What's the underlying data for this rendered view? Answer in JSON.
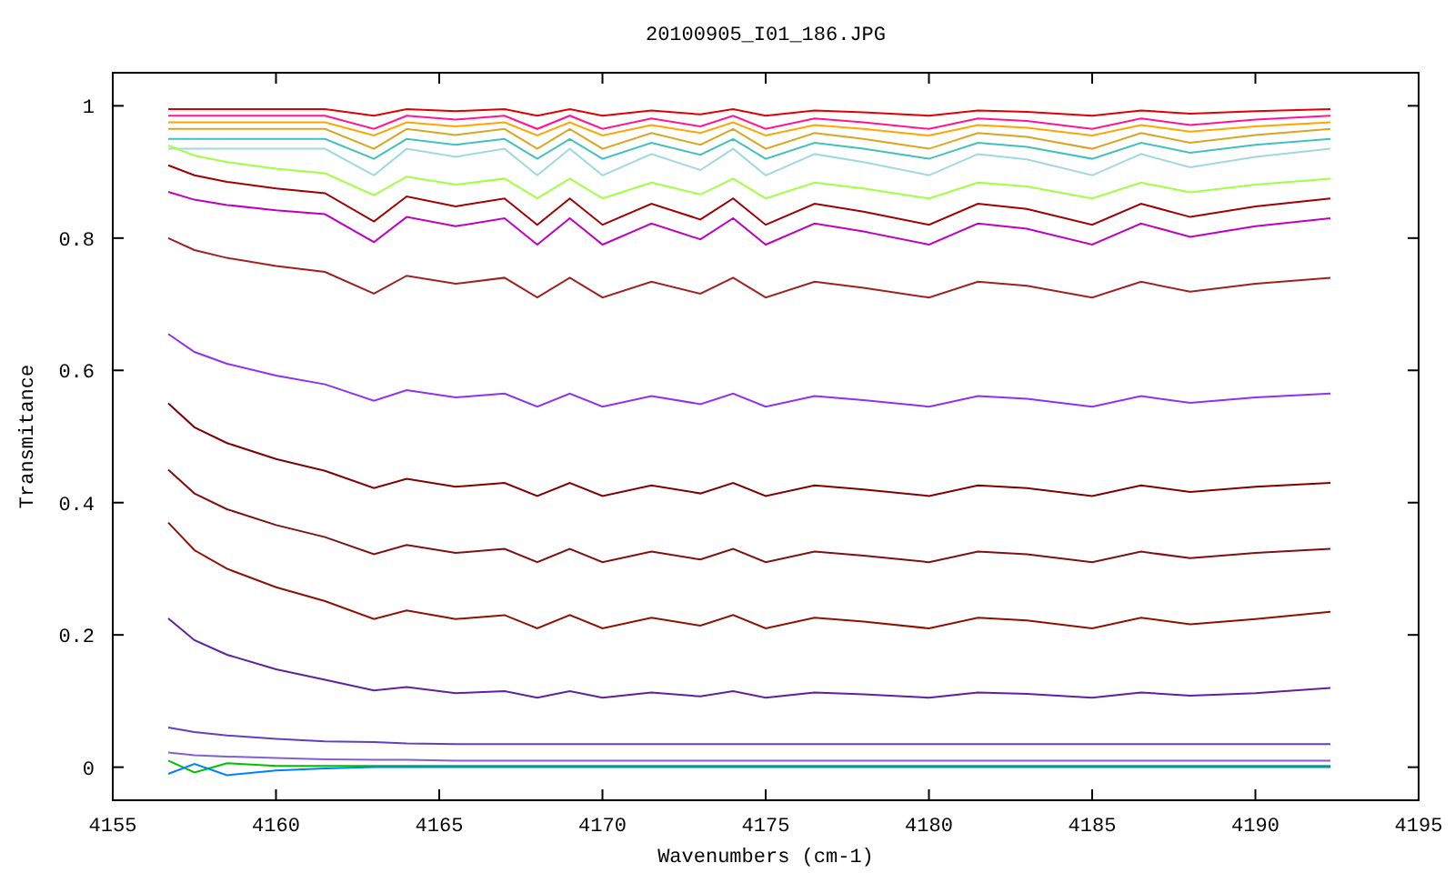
{
  "chart": {
    "chart_data": {
      "type": "line",
      "title": "20100905_I01_186.JPG",
      "xlabel": "Wavenumbers (cm-1)",
      "ylabel": "Transmitance",
      "x": [
        4156.7,
        4157.5,
        4158.5,
        4160,
        4161.5,
        4163,
        4164,
        4165.5,
        4167,
        4168,
        4169,
        4170,
        4171.5,
        4173,
        4174,
        4175,
        4176.5,
        4178,
        4180,
        4181.5,
        4183,
        4185,
        4186.5,
        4188,
        4190,
        4192.3
      ],
      "series": [
        {
          "color": "#e00000",
          "values": [
            0.995,
            0.995,
            0.995,
            0.995,
            0.995,
            0.985,
            0.995,
            0.992,
            0.995,
            0.985,
            0.995,
            0.985,
            0.993,
            0.987,
            0.995,
            0.985,
            0.993,
            0.99,
            0.985,
            0.993,
            0.991,
            0.985,
            0.993,
            0.988,
            0.992,
            0.995
          ]
        },
        {
          "color": "#ff1493",
          "values": [
            0.985,
            0.985,
            0.985,
            0.985,
            0.985,
            0.965,
            0.985,
            0.979,
            0.985,
            0.965,
            0.985,
            0.965,
            0.981,
            0.969,
            0.985,
            0.965,
            0.981,
            0.975,
            0.965,
            0.981,
            0.977,
            0.965,
            0.981,
            0.971,
            0.979,
            0.985
          ]
        },
        {
          "color": "#ffa500",
          "values": [
            0.975,
            0.975,
            0.975,
            0.975,
            0.975,
            0.955,
            0.975,
            0.969,
            0.975,
            0.955,
            0.975,
            0.955,
            0.971,
            0.959,
            0.975,
            0.955,
            0.971,
            0.965,
            0.955,
            0.971,
            0.967,
            0.955,
            0.971,
            0.961,
            0.969,
            0.975
          ]
        },
        {
          "color": "#daa520",
          "values": [
            0.965,
            0.965,
            0.965,
            0.965,
            0.965,
            0.935,
            0.965,
            0.956,
            0.965,
            0.935,
            0.965,
            0.935,
            0.959,
            0.941,
            0.965,
            0.935,
            0.959,
            0.95,
            0.935,
            0.959,
            0.953,
            0.935,
            0.959,
            0.944,
            0.956,
            0.965
          ]
        },
        {
          "color": "#40c0c0",
          "values": [
            0.95,
            0.95,
            0.95,
            0.95,
            0.95,
            0.92,
            0.95,
            0.941,
            0.95,
            0.92,
            0.95,
            0.92,
            0.944,
            0.926,
            0.95,
            0.92,
            0.944,
            0.935,
            0.92,
            0.944,
            0.938,
            0.92,
            0.944,
            0.929,
            0.941,
            0.95
          ]
        },
        {
          "color": "#a0d8e0",
          "values": [
            0.935,
            0.935,
            0.935,
            0.935,
            0.935,
            0.895,
            0.935,
            0.923,
            0.935,
            0.895,
            0.935,
            0.895,
            0.927,
            0.903,
            0.935,
            0.895,
            0.927,
            0.915,
            0.895,
            0.927,
            0.919,
            0.895,
            0.927,
            0.907,
            0.923,
            0.935
          ]
        },
        {
          "color": "#a0ff40",
          "values": [
            0.94,
            0.925,
            0.915,
            0.905,
            0.898,
            0.865,
            0.893,
            0.881,
            0.89,
            0.86,
            0.89,
            0.86,
            0.884,
            0.866,
            0.89,
            0.86,
            0.884,
            0.875,
            0.86,
            0.884,
            0.878,
            0.86,
            0.884,
            0.869,
            0.881,
            0.89
          ]
        },
        {
          "color": "#a00000",
          "values": [
            0.91,
            0.895,
            0.885,
            0.875,
            0.868,
            0.825,
            0.863,
            0.848,
            0.86,
            0.82,
            0.86,
            0.82,
            0.852,
            0.828,
            0.86,
            0.82,
            0.852,
            0.84,
            0.82,
            0.852,
            0.844,
            0.82,
            0.852,
            0.832,
            0.848,
            0.86
          ]
        },
        {
          "color": "#c000c0",
          "values": [
            0.87,
            0.858,
            0.85,
            0.842,
            0.836,
            0.794,
            0.832,
            0.818,
            0.83,
            0.79,
            0.83,
            0.79,
            0.822,
            0.798,
            0.83,
            0.79,
            0.822,
            0.81,
            0.79,
            0.822,
            0.814,
            0.79,
            0.822,
            0.802,
            0.818,
            0.83
          ]
        },
        {
          "color": "#a02020",
          "values": [
            0.8,
            0.782,
            0.77,
            0.758,
            0.749,
            0.716,
            0.743,
            0.731,
            0.74,
            0.71,
            0.74,
            0.71,
            0.734,
            0.716,
            0.74,
            0.71,
            0.734,
            0.725,
            0.71,
            0.734,
            0.728,
            0.71,
            0.734,
            0.719,
            0.731,
            0.74
          ]
        },
        {
          "color": "#9030f0",
          "values": [
            0.655,
            0.628,
            0.61,
            0.592,
            0.579,
            0.554,
            0.57,
            0.559,
            0.565,
            0.545,
            0.565,
            0.545,
            0.561,
            0.549,
            0.565,
            0.545,
            0.561,
            0.555,
            0.545,
            0.561,
            0.557,
            0.545,
            0.561,
            0.551,
            0.559,
            0.565
          ]
        },
        {
          "color": "#800000",
          "values": [
            0.55,
            0.514,
            0.49,
            0.466,
            0.448,
            0.422,
            0.436,
            0.424,
            0.43,
            0.41,
            0.43,
            0.41,
            0.426,
            0.414,
            0.43,
            0.41,
            0.426,
            0.42,
            0.41,
            0.426,
            0.422,
            0.41,
            0.426,
            0.416,
            0.424,
            0.43
          ]
        },
        {
          "color": "#801010",
          "values": [
            0.45,
            0.414,
            0.39,
            0.366,
            0.348,
            0.322,
            0.336,
            0.324,
            0.33,
            0.31,
            0.33,
            0.31,
            0.326,
            0.314,
            0.33,
            0.31,
            0.326,
            0.32,
            0.31,
            0.326,
            0.322,
            0.31,
            0.326,
            0.316,
            0.324,
            0.33
          ]
        },
        {
          "color": "#901000",
          "values": [
            0.37,
            0.328,
            0.3,
            0.272,
            0.251,
            0.224,
            0.237,
            0.224,
            0.23,
            0.21,
            0.23,
            0.21,
            0.226,
            0.214,
            0.23,
            0.21,
            0.226,
            0.22,
            0.21,
            0.226,
            0.222,
            0.21,
            0.226,
            0.216,
            0.224,
            0.235
          ]
        },
        {
          "color": "#6020a0",
          "values": [
            0.225,
            0.192,
            0.17,
            0.148,
            0.132,
            0.116,
            0.121,
            0.112,
            0.115,
            0.105,
            0.115,
            0.105,
            0.113,
            0.107,
            0.115,
            0.105,
            0.113,
            0.11,
            0.105,
            0.113,
            0.111,
            0.105,
            0.113,
            0.108,
            0.112,
            0.12
          ]
        },
        {
          "color": "#6040c0",
          "values": [
            0.06,
            0.053,
            0.048,
            0.043,
            0.039,
            0.038,
            0.036,
            0.035,
            0.035,
            0.035,
            0.035,
            0.035,
            0.035,
            0.035,
            0.035,
            0.035,
            0.035,
            0.035,
            0.035,
            0.035,
            0.035,
            0.035,
            0.035,
            0.035,
            0.035,
            0.035
          ]
        },
        {
          "color": "#8060d0",
          "values": [
            0.022,
            0.018,
            0.016,
            0.014,
            0.012,
            0.011,
            0.011,
            0.01,
            0.01,
            0.01,
            0.01,
            0.01,
            0.01,
            0.01,
            0.01,
            0.01,
            0.01,
            0.01,
            0.01,
            0.01,
            0.01,
            0.01,
            0.01,
            0.01,
            0.01,
            0.01
          ]
        },
        {
          "color": "#00c000",
          "values": [
            0.01,
            -0.008,
            0.006,
            0.002,
            0.002,
            0.002,
            0.002,
            0.002,
            0.002,
            0.002,
            0.002,
            0.002,
            0.002,
            0.002,
            0.002,
            0.002,
            0.002,
            0.002,
            0.002,
            0.002,
            0.002,
            0.002,
            0.002,
            0.002,
            0.002,
            0.002
          ]
        },
        {
          "color": "#0080ff",
          "values": [
            -0.01,
            0.005,
            -0.012,
            -0.005,
            -0.002,
            0,
            0,
            0,
            0,
            0,
            0,
            0,
            0,
            0,
            0,
            0,
            0,
            0,
            0,
            0,
            0,
            0,
            0,
            0,
            0,
            0
          ]
        }
      ],
      "xlim": [
        4155,
        4195
      ],
      "ylim": [
        -0.05,
        1.05
      ],
      "xticks": [
        4155,
        4160,
        4165,
        4170,
        4175,
        4180,
        4185,
        4190,
        4195
      ],
      "yticks": [
        0,
        0.2,
        0.4,
        0.6,
        0.8,
        1
      ]
    }
  }
}
